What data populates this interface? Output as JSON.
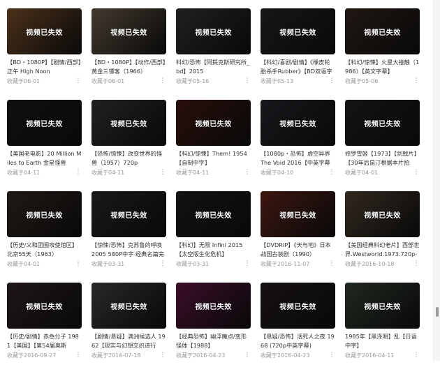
{
  "invalid_label": "视频已失效",
  "items": [
    {
      "title": "【BD・1080P】【剧情/西部】正午 High Noon",
      "date": "收藏于06-01"
    },
    {
      "title": "【BD・1080P】【动作/西部】黄金三镖客（1966）",
      "date": "收藏于06-01"
    },
    {
      "title": "科幻/恐怖【阿提克斯研究所_bd】2015",
      "date": "收藏于05-16"
    },
    {
      "title": "【科幻/喜剧/剧情】《橡皮轮胎杀手Rubber》【BD双语字",
      "date": "收藏于05-13"
    },
    {
      "title": "【科幻/惊悚】火星大接触（1986）【英文字幕】",
      "date": "收藏于05-06"
    },
    {
      "title": "【美国老电影】20 Million Miles to Earth 金星怪兽",
      "date": "收藏于04-11"
    },
    {
      "title": "【恐怖/惊悚】改变世界的怪兽（1957）720p",
      "date": "收藏于04-11"
    },
    {
      "title": "【科幻/惊悚】Them! 1954【自制中字】",
      "date": "收藏于04-11"
    },
    {
      "title": "【1080p・恐怖】虚空异界 The Void 2016【中英字幕",
      "date": "收藏于04-10"
    },
    {
      "title": "修罗雪姬【1973】【剑戟片】【30年后昆汀根据本片拍",
      "date": "收藏于04-01"
    },
    {
      "title": "【历史/义和团围攻使馆区】北京55天（1963）",
      "date": "收藏于04-01"
    },
    {
      "title": "【惊悚/恐怖】克苏鲁的呼唤 2005 580P中字 经典名篇完",
      "date": "收藏于03-31"
    },
    {
      "title": "【科幻】无限 Infini 2015【太空版生化危机】",
      "date": "收藏于03-31"
    },
    {
      "title": "【DVDRIP】《天与地》日本战国古装剧（1990）",
      "date": "收藏于2016-11-07"
    },
    {
      "title": "【美国经典科幻老片】西部世界.Westworld.1973.720p-",
      "date": "收藏于2016-10-18"
    },
    {
      "title": "【历史/剧情】赤色分子 1981【美国】【第54届奥斯",
      "date": "收藏于2016-09-27"
    },
    {
      "title": "【剧情/悬疑】满洲候选人 1962【现实与幻想交织进行",
      "date": "收藏于2016-07-18"
    },
    {
      "title": "【经典恐怖】幽浮魔点/变形怪体【1988】",
      "date": "收藏于2016-04-23"
    },
    {
      "title": "【悬疑/恐怖】活死人之夜 1968 (720p中英字幕)",
      "date": "收藏于2016-04-23"
    },
    {
      "title": "1985年【黑泽明】乱【日语中字】",
      "date": "收藏于2016-04-11"
    }
  ],
  "more_icon": "⋮",
  "colors": {
    "thumbs": [
      "#8a5a30",
      "#7a6a55",
      "#3a3a3a",
      "#2a2a2a",
      "#3a2a22",
      "#1e1e1e",
      "#3c3c3c",
      "#4a1c14",
      "#2c2c34",
      "#242424",
      "#3a2e28",
      "#2e2e2e",
      "#222222",
      "#6e2a1e",
      "#5a4a3a",
      "#3a2a2a",
      "#4a4a4a",
      "#6a1a4a",
      "#2a2020",
      "#3a4a3a"
    ]
  }
}
